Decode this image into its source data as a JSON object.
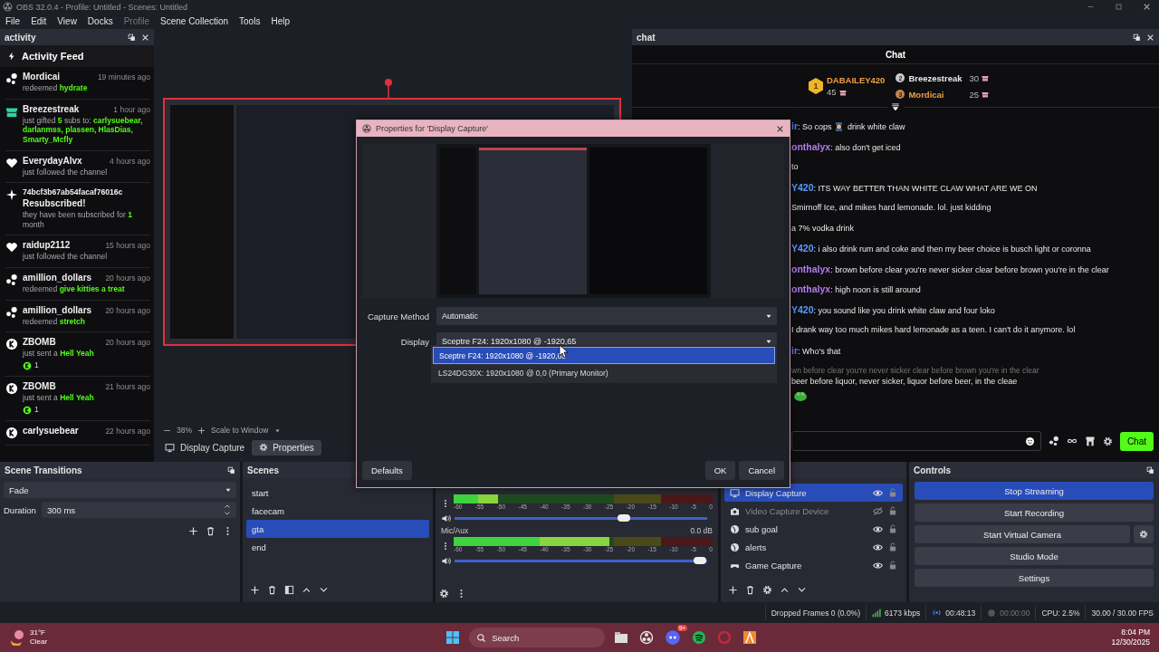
{
  "window": {
    "title": "OBS 32.0.4 - Profile: Untitled - Scenes: Untitled"
  },
  "menu": [
    {
      "label": "File",
      "disabled": false
    },
    {
      "label": "Edit",
      "disabled": false
    },
    {
      "label": "View",
      "disabled": false
    },
    {
      "label": "Docks",
      "disabled": false
    },
    {
      "label": "Profile",
      "disabled": true
    },
    {
      "label": "Scene Collection",
      "disabled": false
    },
    {
      "label": "Tools",
      "disabled": false
    },
    {
      "label": "Help",
      "disabled": false
    }
  ],
  "activity_dock": {
    "title": "activity",
    "heading": "Activity Feed",
    "items": [
      {
        "kind": "points",
        "user": "Mordicai",
        "time": "19 minutes ago",
        "detail": [
          {
            "text": "redeemed",
            "accent": false
          },
          {
            "text": "hydrate",
            "accent": true
          }
        ]
      },
      {
        "kind": "gift",
        "user": "Breezestreak",
        "time": "1 hour ago",
        "detail": [
          {
            "text": "just gifted",
            "accent": false
          },
          {
            "text": "5",
            "accent": true
          },
          {
            "text": "subs to:",
            "accent": false
          },
          {
            "text": "carlysuebear, darlanmss, plassen, HlasDias, Smarty_Mcfly",
            "accent": true
          }
        ]
      },
      {
        "kind": "follow",
        "user": "EverydayAlvx",
        "time": "4 hours ago",
        "detail": [
          {
            "text": "just followed the channel",
            "accent": false
          }
        ]
      },
      {
        "kind": "resub",
        "user": "74bcf3b67ab54facaf76016c",
        "headline": "Resubscribed!",
        "detail": [
          {
            "text": "they have been subscribed for",
            "accent": false
          },
          {
            "text": "1",
            "accent": true
          },
          {
            "text": "month",
            "accent": false
          }
        ]
      },
      {
        "kind": "follow",
        "user": "raidup2112",
        "time": "15 hours ago",
        "detail": [
          {
            "text": "just followed the channel",
            "accent": false
          }
        ]
      },
      {
        "kind": "points",
        "user": "amillion_dollars",
        "time": "20 hours ago",
        "detail": [
          {
            "text": "redeemed",
            "accent": false
          },
          {
            "text": "give kitties a treat",
            "accent": true
          }
        ]
      },
      {
        "kind": "points",
        "user": "amillion_dollars",
        "time": "20 hours ago",
        "detail": [
          {
            "text": "redeemed",
            "accent": false
          },
          {
            "text": "stretch",
            "accent": true
          }
        ]
      },
      {
        "kind": "kick",
        "user": "ZBOMB",
        "time": "20 hours ago",
        "detail": [
          {
            "text": "just sent a",
            "accent": false
          },
          {
            "text": "Hell Yeah",
            "accent": true
          }
        ],
        "amount": "1"
      },
      {
        "kind": "kick",
        "user": "ZBOMB",
        "time": "21 hours ago",
        "detail": [
          {
            "text": "just sent a",
            "accent": false
          },
          {
            "text": "Hell Yeah",
            "accent": true
          }
        ],
        "amount": "1"
      },
      {
        "kind": "kick",
        "user": "carlysuebear",
        "time": "22 hours ago"
      }
    ]
  },
  "preview": {
    "zoom": "38%",
    "scale_mode": "Scale to Window"
  },
  "source_toolbar": {
    "source": "Display Capture",
    "properties": "Properties"
  },
  "chat_dock": {
    "title": "chat",
    "heading": "Chat",
    "leaderboard": [
      {
        "rank": "1",
        "name": "DABAILEY420",
        "count": "45",
        "color": "#f0a040"
      },
      {
        "rank": "2",
        "name": "Breezestreak",
        "count": "30",
        "color": "#e8e8e8"
      },
      {
        "rank": "3",
        "name": "Mordicai",
        "count": "25",
        "color": "#f0a040"
      }
    ],
    "messages": [
      {
        "kind": "message",
        "user": "ir",
        "color": "#5b7cff",
        "separator": ":",
        "segments": [
          {
            "kind": "text",
            "text": "So cops"
          },
          {
            "kind": "emote"
          },
          {
            "kind": "text",
            "text": "drink white claw"
          }
        ]
      },
      {
        "kind": "message",
        "user": "onthalyx",
        "color": "#b07cf0",
        "separator": ":",
        "segments": [
          {
            "kind": "text",
            "text": "also don't get iced"
          }
        ]
      },
      {
        "kind": "message",
        "segments": [
          {
            "kind": "text",
            "text": "to"
          }
        ]
      },
      {
        "kind": "message",
        "user": "Y420",
        "color": "#5b9cff",
        "separator": ":",
        "segments": [
          {
            "kind": "text",
            "text": "ITS WAY BETTER THAN WHITE CLAW WHAT ARE WE ON"
          }
        ]
      },
      {
        "kind": "message",
        "segments": [
          {
            "kind": "text",
            "text": "Smirnoff Ice, and mikes hard lemonade. lol. just kidding"
          }
        ]
      },
      {
        "kind": "message",
        "segments": [
          {
            "kind": "text",
            "text": "a 7% vodka drink"
          }
        ]
      },
      {
        "kind": "message",
        "user": "Y420",
        "color": "#5b9cff",
        "separator": ":",
        "segments": [
          {
            "kind": "text",
            "text": "i also drink rum and coke and then my beer choice is busch light or coronna"
          }
        ]
      },
      {
        "kind": "message",
        "user": "onthalyx",
        "color": "#b07cf0",
        "separator": ":",
        "segments": [
          {
            "kind": "text",
            "text": "brown before clear you're never sicker clear before brown you're in the clear"
          }
        ]
      },
      {
        "kind": "message",
        "user": "onthalyx",
        "color": "#b07cf0",
        "separator": ":",
        "segments": [
          {
            "kind": "text",
            "text": "high noon is still around"
          }
        ]
      },
      {
        "kind": "message",
        "user": "Y420",
        "color": "#5b9cff",
        "separator": ":",
        "segments": [
          {
            "kind": "text",
            "text": "you sound like you drink white claw and four loko"
          }
        ]
      },
      {
        "kind": "message",
        "segments": [
          {
            "kind": "text",
            "text": "I drank way too much mikes hard lemonade as a teen. I can't do it anymore. lol"
          }
        ]
      },
      {
        "kind": "message",
        "user": "ir",
        "color": "#5b7cff",
        "separator": ":",
        "segments": [
          {
            "kind": "text",
            "text": "Who's that"
          }
        ]
      },
      {
        "kind": "reply",
        "segments": [
          {
            "kind": "text",
            "text": "wn before clear you're never sicker clear before brown you're in the clear"
          }
        ]
      },
      {
        "kind": "message",
        "segments": [
          {
            "kind": "text",
            "text": "beer before liquor, never sicker, liquor before beer, in the cleae"
          }
        ]
      },
      {
        "kind": "message",
        "segments": [
          {
            "kind": "emote"
          }
        ]
      }
    ],
    "send": "Chat"
  },
  "properties_dialog": {
    "title": "Properties for 'Display Capture'",
    "fields": [
      {
        "label": "Capture Method",
        "value": "Automatic"
      },
      {
        "label": "Display",
        "value": "Sceptre F24: 1920x1080 @ -1920,65"
      }
    ],
    "display_options": [
      {
        "label": "Sceptre F24: 1920x1080 @ -1920,65",
        "selected": true
      },
      {
        "label": "LS24DG30X: 1920x1080 @ 0,0 (Primary Monitor)",
        "selected": false
      }
    ],
    "defaults": "Defaults",
    "ok": "OK",
    "cancel": "Cancel"
  },
  "scene_transitions": {
    "title": "Scene Transitions",
    "transition": "Fade",
    "duration_label": "Duration",
    "duration": "300 ms"
  },
  "scenes": {
    "title": "Scenes",
    "items": [
      {
        "name": "start",
        "selected": false
      },
      {
        "name": "facecam",
        "selected": false
      },
      {
        "name": "gta",
        "selected": true
      },
      {
        "name": "end",
        "selected": false
      }
    ]
  },
  "audio_mixer": {
    "tracks": [
      {
        "meter": {
          "level": 0.17
        },
        "scale": [
          "-60",
          "-55",
          "-50",
          "-45",
          "-40",
          "-35",
          "-30",
          "-25",
          "-20",
          "-15",
          "-10",
          "-5",
          "0"
        ],
        "fader": {
          "level": 0.67
        }
      },
      {
        "name": "Mic/Aux",
        "volume": "0.0 dB",
        "meter": {
          "level": 0.6
        },
        "scale": [
          "-60",
          "-55",
          "-50",
          "-45",
          "-40",
          "-35",
          "-30",
          "-25",
          "-20",
          "-15",
          "-10",
          "-5",
          "0"
        ],
        "fader": {
          "level": 0.97
        }
      }
    ]
  },
  "sources": {
    "items": [
      {
        "name": "Display Capture",
        "kind": "monitor",
        "selected": true,
        "visible": true,
        "locked": false
      },
      {
        "name": "Video Capture Device",
        "kind": "camera",
        "selected": false,
        "visible": false,
        "locked": false
      },
      {
        "name": "sub goal",
        "kind": "browser",
        "selected": false,
        "visible": true,
        "locked": false
      },
      {
        "name": "alerts",
        "kind": "browser",
        "selected": false,
        "visible": true,
        "locked": false
      },
      {
        "name": "Game Capture",
        "kind": "game",
        "selected": false,
        "visible": true,
        "locked": false
      }
    ]
  },
  "controls": {
    "title": "Controls",
    "buttons": [
      {
        "label": "Stop Streaming",
        "active": true,
        "settings": false
      },
      {
        "label": "Start Recording",
        "active": false,
        "settings": false
      },
      {
        "label": "Start Virtual Camera",
        "active": false,
        "settings": true
      },
      {
        "label": "Studio Mode",
        "active": false,
        "settings": false
      },
      {
        "label": "Settings",
        "active": false,
        "settings": false
      }
    ]
  },
  "status_bar": {
    "dropped_frames": "Dropped Frames 0 (0.0%)",
    "bitrate": "6173 kbps",
    "stream_time": "00:48:13",
    "record_time": "00:00:00",
    "cpu": "CPU: 2.5%",
    "fps": "30.00 / 30.00 FPS"
  },
  "taskbar": {
    "temperature": "31°F",
    "condition": "Clear",
    "search": "Search",
    "discord_badge": "9+",
    "time": "8:04 PM",
    "date": "12/30/2025"
  }
}
